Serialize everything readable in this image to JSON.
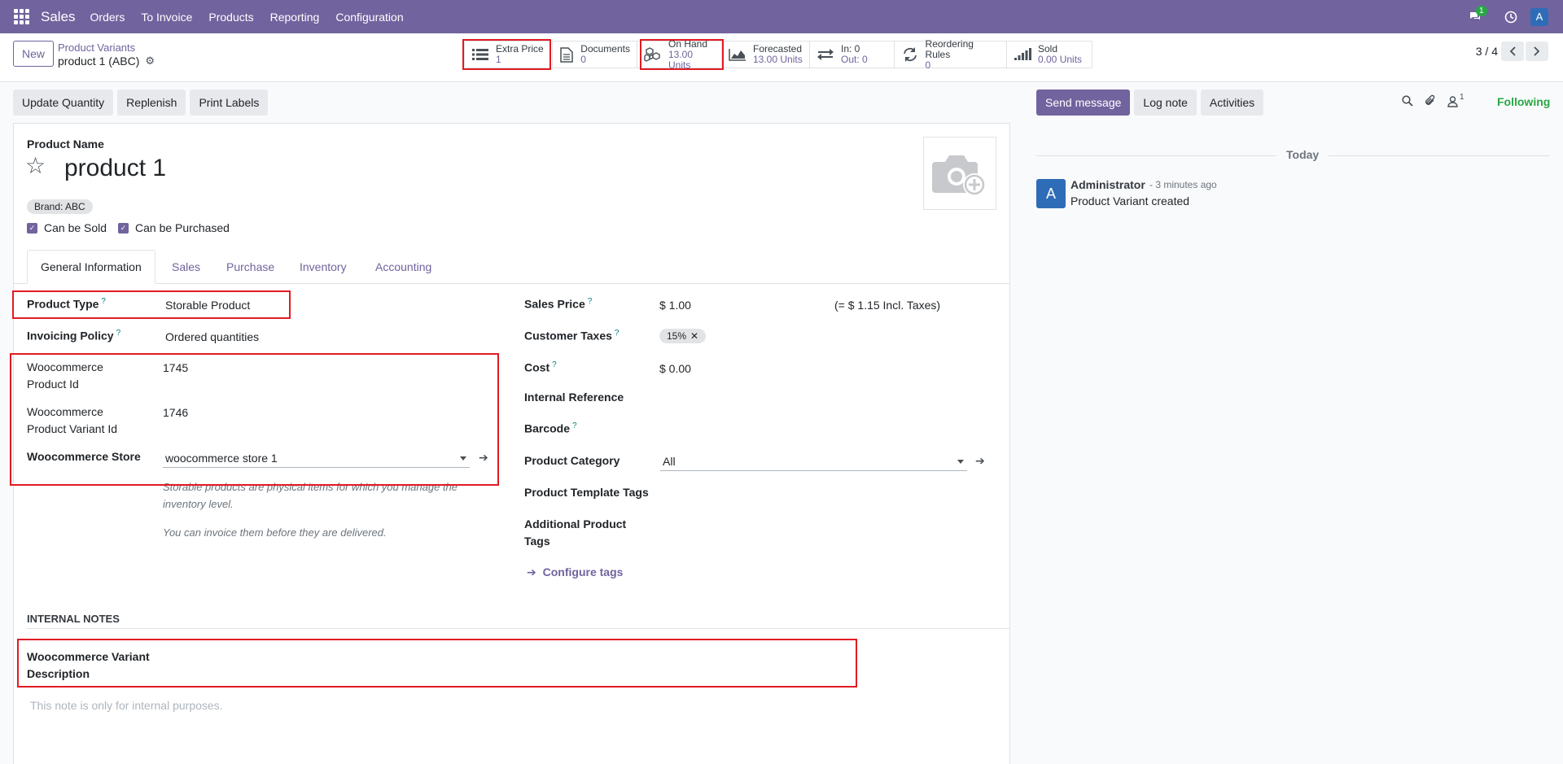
{
  "navbar": {
    "app_name": "Sales",
    "menu": [
      "Orders",
      "To Invoice",
      "Products",
      "Reporting",
      "Configuration"
    ],
    "message_count": "1",
    "avatar_letter": "A"
  },
  "control": {
    "new_label": "New",
    "breadcrumb": "Product Variants",
    "record_name": "product 1 (ABC)",
    "pager": "3 / 4",
    "smart_buttons": [
      {
        "title": "Extra Price",
        "value": "1"
      },
      {
        "title": "Documents",
        "value": "0"
      },
      {
        "title": "On Hand",
        "value": "13.00 Units"
      },
      {
        "title": "Forecasted",
        "value": "13.00 Units"
      },
      {
        "title": "In: 0",
        "value": "Out: 0"
      },
      {
        "title": "Reordering Rules",
        "value": "0"
      },
      {
        "title": "Sold",
        "value": "0.00 Units"
      }
    ]
  },
  "actions": [
    "Update Quantity",
    "Replenish",
    "Print Labels"
  ],
  "form": {
    "product_name_label": "Product Name",
    "product_name": "product 1",
    "brand_tag": "Brand: ABC",
    "can_be_sold": "Can be Sold",
    "can_be_purchased": "Can be Purchased",
    "tabs": [
      "General Information",
      "Sales",
      "Purchase",
      "Inventory",
      "Accounting"
    ],
    "left": {
      "product_type_label": "Product Type",
      "product_type": "Storable Product",
      "invoicing_policy_label": "Invoicing Policy",
      "invoicing_policy": "Ordered quantities",
      "woo_product_id_label_1": "Woocommerce",
      "woo_product_id_label_2": "Product Id",
      "woo_product_id": "1745",
      "woo_variant_id_label_1": "Woocommerce",
      "woo_variant_id_label_2": "Product Variant Id",
      "woo_variant_id": "1746",
      "woo_store_label": "Woocommerce Store",
      "woo_store": "woocommerce store 1",
      "help_storable_1": "Storable products are physical items for which you manage the",
      "help_storable_2": "inventory level.",
      "help_invoice": "You can invoice them before they are delivered."
    },
    "right": {
      "sales_price_label": "Sales Price",
      "sales_price": "$ 1.00",
      "incl_taxes": "(= $ 1.15 Incl. Taxes)",
      "customer_taxes_label": "Customer Taxes",
      "tax_tag": "15%",
      "cost_label": "Cost",
      "cost": "$ 0.00",
      "internal_ref_label": "Internal Reference",
      "barcode_label": "Barcode",
      "category_label": "Product Category",
      "category": "All",
      "template_tags_label": "Product Template Tags",
      "additional_tags_label_1": "Additional Product",
      "additional_tags_label_2": "Tags",
      "configure_tags": "Configure tags"
    },
    "internal_notes_title": "INTERNAL NOTES",
    "woo_variant_desc_label_1": "Woocommerce Variant",
    "woo_variant_desc_label_2": "Description",
    "note_placeholder": "This note is only for internal purposes."
  },
  "chatter": {
    "send_message": "Send message",
    "log_note": "Log note",
    "activities": "Activities",
    "followers_count": "1",
    "following": "Following",
    "today": "Today",
    "message": {
      "avatar": "A",
      "author": "Administrator",
      "time": "- 3 minutes ago",
      "body": "Product Variant created"
    }
  },
  "colors": {
    "brand": "#71639e",
    "highlight": "#e11b22",
    "following": "#28a745"
  }
}
